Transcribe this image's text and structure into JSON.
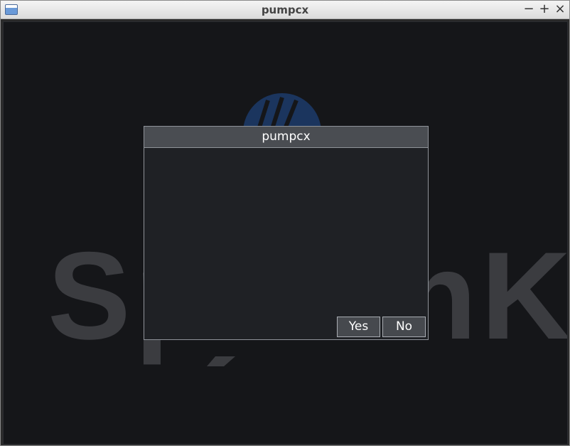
{
  "window": {
    "title": "pumpcx",
    "controls": {
      "minimize": "−",
      "maximize": "+",
      "close": "×"
    }
  },
  "dialog": {
    "title": "pumpcx",
    "buttons": {
      "yes": "Yes",
      "no": "No"
    }
  },
  "background_logo": {
    "icon": "splashkit-logo",
    "text": "SplashKit"
  },
  "colors": {
    "canvas_bg": "#151619",
    "dialog_bg": "#1f2125",
    "dialog_header": "#4a4d52",
    "button_bg": "#46494e",
    "logo_text": "#3b3c40",
    "logo_accent": "#1b355e"
  }
}
